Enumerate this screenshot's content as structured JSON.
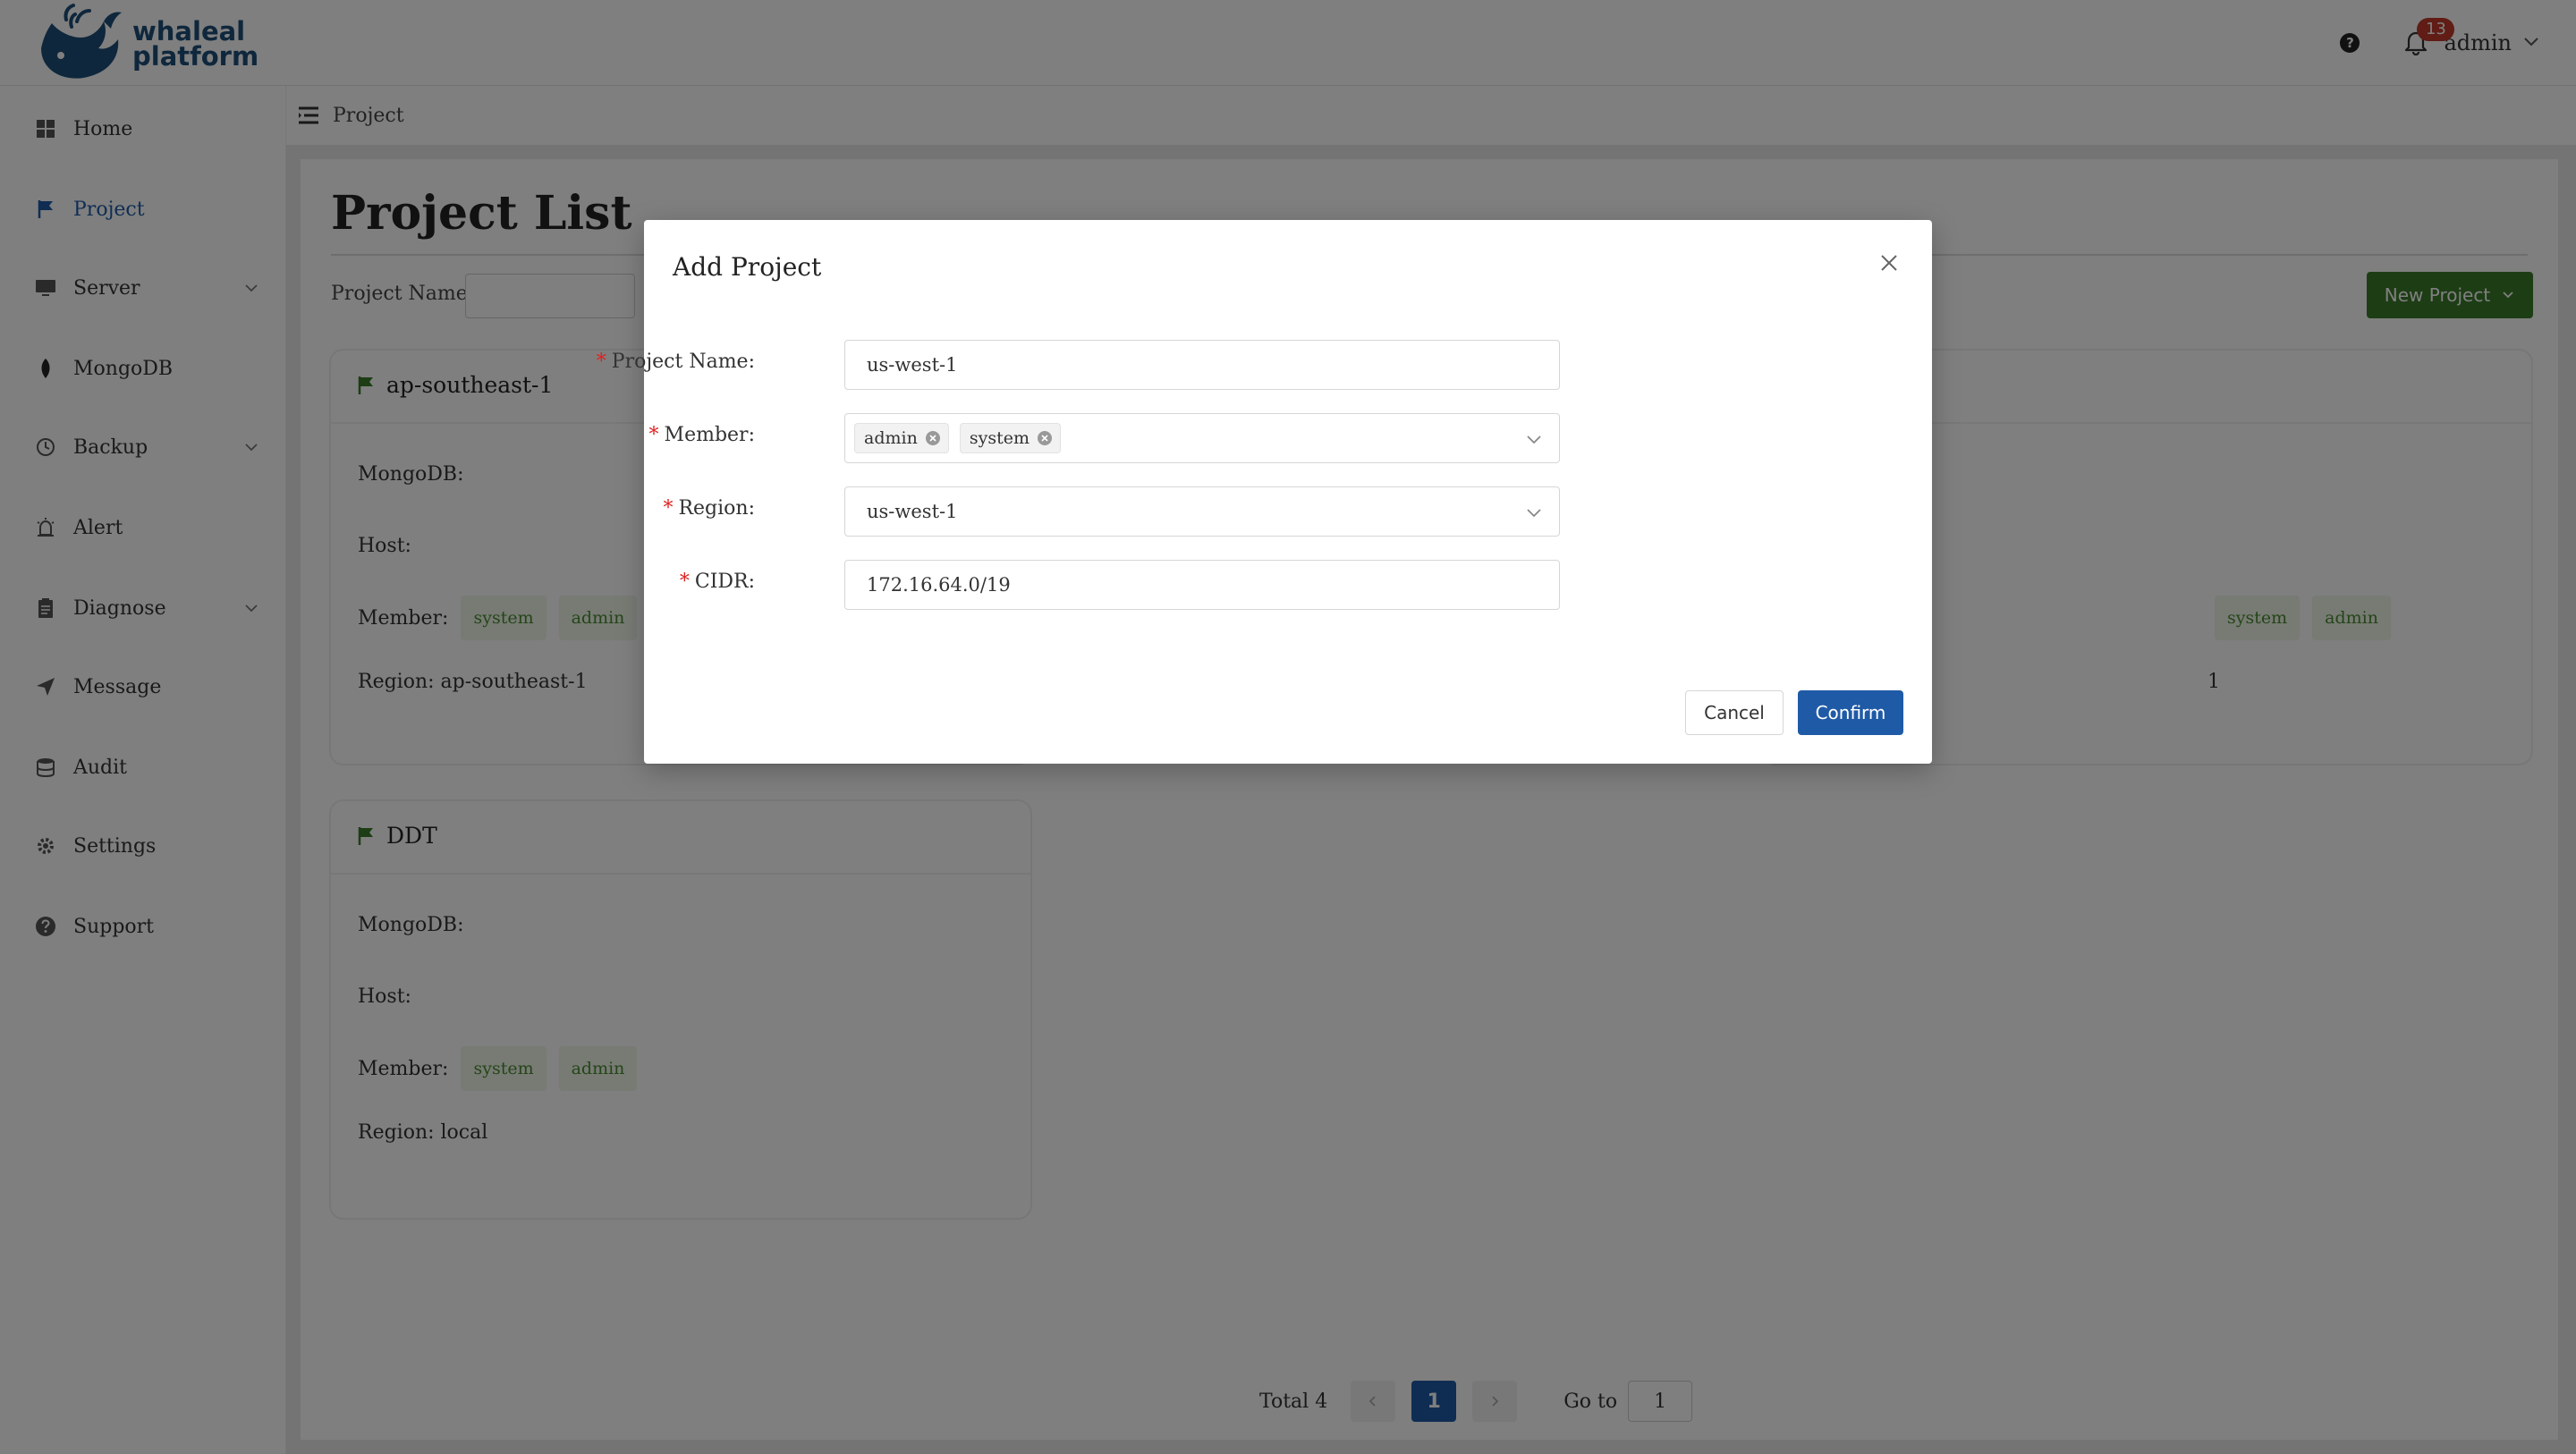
{
  "header": {
    "logo_line1": "whaleal",
    "logo_line2": "platform",
    "help_glyph": "?",
    "notification_count": "13",
    "user_name": "admin"
  },
  "sidebar": {
    "items": [
      {
        "label": "Home",
        "icon": "grid-icon"
      },
      {
        "label": "Project",
        "icon": "flag-icon",
        "active": true
      },
      {
        "label": "Server",
        "icon": "monitor-icon",
        "has_submenu": true
      },
      {
        "label": "MongoDB",
        "icon": "leaf-icon"
      },
      {
        "label": "Backup",
        "icon": "backup-icon",
        "has_submenu": true
      },
      {
        "label": "Alert",
        "icon": "alarm-icon"
      },
      {
        "label": "Diagnose",
        "icon": "clipboard-icon",
        "has_submenu": true
      },
      {
        "label": "Message",
        "icon": "send-icon"
      },
      {
        "label": "Audit",
        "icon": "database-icon"
      },
      {
        "label": "Settings",
        "icon": "gear-icon"
      },
      {
        "label": "Support",
        "icon": "question-icon"
      }
    ]
  },
  "breadcrumb": {
    "label": "Project"
  },
  "page": {
    "title": "Project List",
    "filter_label": "Project Name",
    "new_button": "New Project"
  },
  "cards": [
    {
      "name": "ap-southeast-1",
      "mongodb_label": "MongoDB:",
      "host_label": "Host:",
      "member_label": "Member:",
      "members": [
        "system",
        "admin"
      ],
      "region_text": "Region: ap-southeast-1"
    },
    {
      "name": "DDT",
      "mongodb_label": "MongoDB:",
      "host_label": "Host:",
      "member_label": "Member:",
      "members": [
        "system",
        "admin"
      ],
      "region_text": "Region: local"
    },
    {
      "name": "",
      "members": [
        "system",
        "admin"
      ],
      "region_text": "1"
    }
  ],
  "pagination": {
    "total_text": "Total 4",
    "current_page": "1",
    "goto_label": "Go to",
    "goto_value": "1"
  },
  "modal": {
    "title": "Add Project",
    "fields": {
      "project_name": {
        "label": "Project Name:",
        "value": "us-west-1"
      },
      "member": {
        "label": "Member:",
        "tags": [
          "admin",
          "system"
        ]
      },
      "region": {
        "label": "Region:",
        "value": "us-west-1"
      },
      "cidr": {
        "label": "CIDR:",
        "value": "172.16.64.0/19"
      }
    },
    "required_mark": "*",
    "cancel_label": "Cancel",
    "confirm_label": "Confirm"
  },
  "colors": {
    "primary": "#1f5aa6",
    "success": "#3b7a2a",
    "badge": "#c0392b",
    "brand": "#1f4e79"
  }
}
